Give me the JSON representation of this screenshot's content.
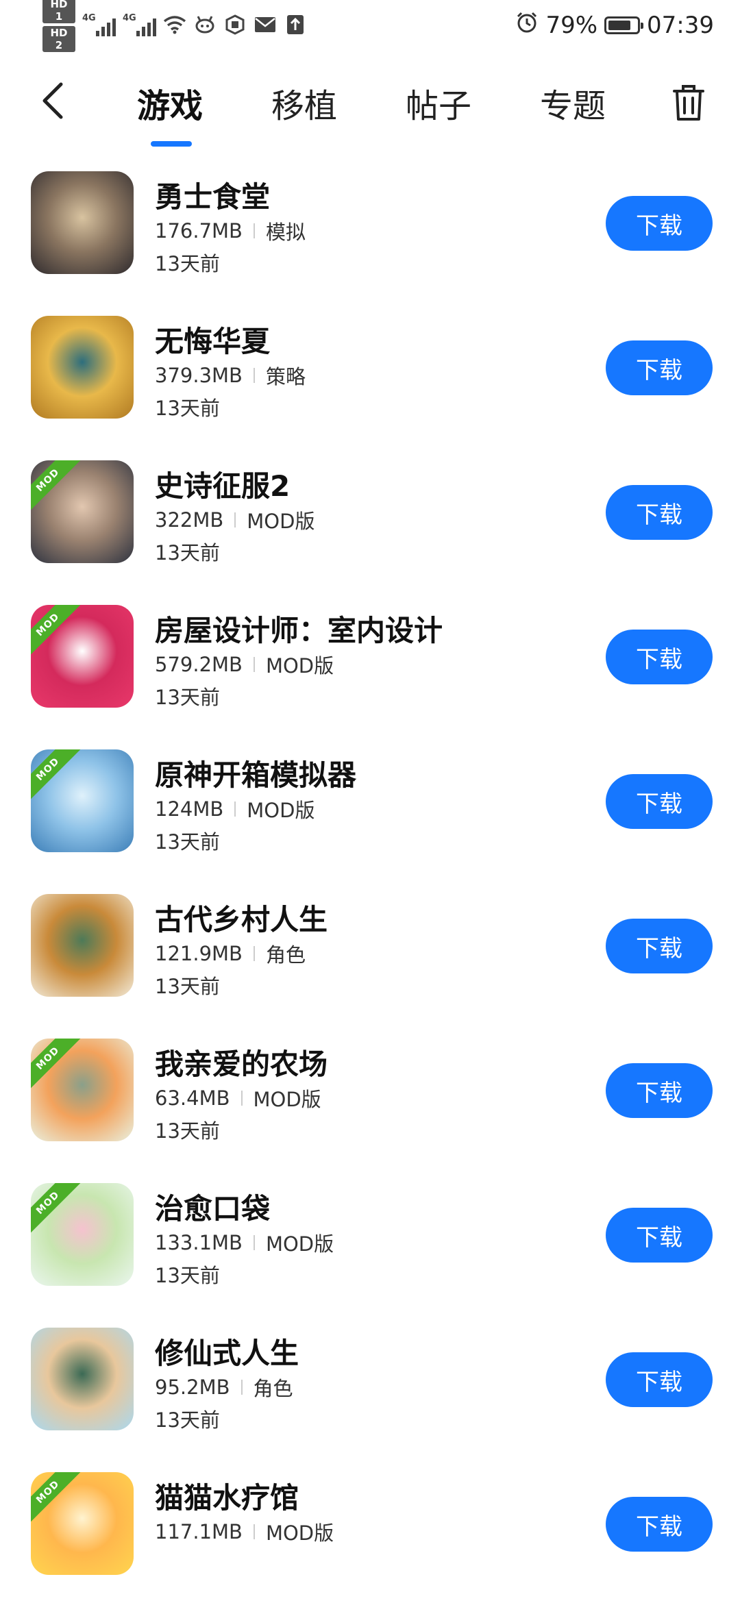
{
  "status_bar": {
    "hd1": "HD 1",
    "hd2": "HD 2",
    "net1": "4G",
    "net2": "4G",
    "battery_percent": "79%",
    "battery_level": 0.79,
    "time": "07:39"
  },
  "nav": {
    "tabs": [
      {
        "label": "游戏",
        "active": true
      },
      {
        "label": "移植",
        "active": false
      },
      {
        "label": "帖子",
        "active": false
      },
      {
        "label": "专题",
        "active": false
      }
    ]
  },
  "colors": {
    "accent": "#1677ff",
    "mod_badge": "#4caf28"
  },
  "mod_badge_text": "MOD",
  "items": [
    {
      "title": "勇士食堂",
      "size": "176.7MB",
      "category": "模拟",
      "time": "13天前",
      "action": "下载",
      "mod": false,
      "icon_name": "warrior-canteen-icon",
      "icon_colors": [
        "#2f2b2e",
        "#8a7560",
        "#d8c3a0"
      ]
    },
    {
      "title": "无悔华夏",
      "size": "379.3MB",
      "category": "策略",
      "time": "13天前",
      "action": "下载",
      "mod": false,
      "icon_name": "wuhui-huaxia-icon",
      "icon_colors": [
        "#b07a22",
        "#e8b84a",
        "#2d6e7d"
      ]
    },
    {
      "title": "史诗征服2",
      "size": "322MB",
      "category": "MOD版",
      "time": "13天前",
      "action": "下载",
      "mod": true,
      "icon_name": "epic-conquest-icon",
      "icon_colors": [
        "#2e3340",
        "#9a8270",
        "#e2c7b0"
      ]
    },
    {
      "title": "房屋设计师：室内设计",
      "size": "579.2MB",
      "category": "MOD版",
      "time": "13天前",
      "action": "下载",
      "mod": true,
      "icon_name": "home-design-icon",
      "icon_colors": [
        "#e8386a",
        "#d42a5c",
        "#ffffff"
      ]
    },
    {
      "title": "原神开箱模拟器",
      "size": "124MB",
      "category": "MOD版",
      "time": "13天前",
      "action": "下载",
      "mod": true,
      "icon_name": "genshin-box-icon",
      "icon_colors": [
        "#3d7fb8",
        "#8fc3e8",
        "#dff1fb"
      ]
    },
    {
      "title": "古代乡村人生",
      "size": "121.9MB",
      "category": "角色",
      "time": "13天前",
      "action": "下载",
      "mod": false,
      "icon_name": "ancient-village-icon",
      "icon_colors": [
        "#f2ead8",
        "#c98a3a",
        "#4d7a58"
      ]
    },
    {
      "title": "我亲爱的农场",
      "size": "63.4MB",
      "category": "MOD版",
      "time": "13天前",
      "action": "下载",
      "mod": true,
      "icon_name": "my-dear-farm-icon",
      "icon_colors": [
        "#e9f0df",
        "#f3a25c",
        "#8aa08a"
      ]
    },
    {
      "title": "治愈口袋",
      "size": "133.1MB",
      "category": "MOD版",
      "time": "13天前",
      "action": "下载",
      "mod": true,
      "icon_name": "healing-pocket-icon",
      "icon_colors": [
        "#eaf6ee",
        "#c8e6b0",
        "#f5c2cf"
      ]
    },
    {
      "title": "修仙式人生",
      "size": "95.2MB",
      "category": "角色",
      "time": "13天前",
      "action": "下载",
      "mod": false,
      "icon_name": "cultivation-life-icon",
      "icon_colors": [
        "#a9d8ef",
        "#e8c79c",
        "#3b6a55"
      ]
    },
    {
      "title": "猫猫水疗馆",
      "size": "117.1MB",
      "category": "MOD版",
      "time": "",
      "action": "下载",
      "mod": true,
      "icon_name": "cat-spa-icon",
      "icon_colors": [
        "#ffd54f",
        "#ffb74d",
        "#fff3d0"
      ]
    }
  ]
}
